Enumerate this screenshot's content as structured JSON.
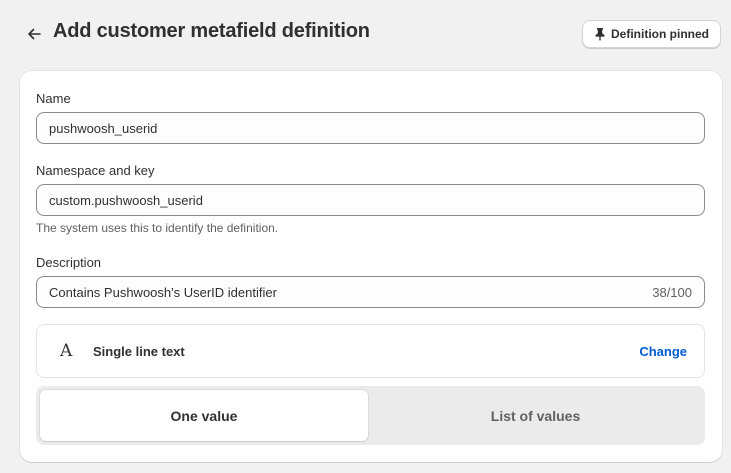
{
  "header": {
    "title": "Add customer metafield definition",
    "back_icon": "arrow-left-icon",
    "pin_button_label": "Definition pinned",
    "pin_icon": "pin-icon"
  },
  "form": {
    "name": {
      "label": "Name",
      "value": "pushwoosh_userid"
    },
    "namespace_key": {
      "label": "Namespace and key",
      "value": "custom.pushwoosh_userid",
      "help": "The system uses this to identify the definition."
    },
    "description": {
      "label": "Description",
      "value": "Contains Pushwoosh's UserID identifier",
      "counter": "38/100"
    },
    "type": {
      "icon_glyph": "A",
      "icon": "text-type-icon",
      "name": "Single line text",
      "change_label": "Change"
    },
    "value_mode": {
      "options": [
        "One value",
        "List of values"
      ],
      "selected": "One value"
    }
  },
  "colors": {
    "background": "#f1f1f1",
    "card": "#ffffff",
    "link": "#005bd3",
    "text": "#303030",
    "subdued_text": "#616161"
  }
}
